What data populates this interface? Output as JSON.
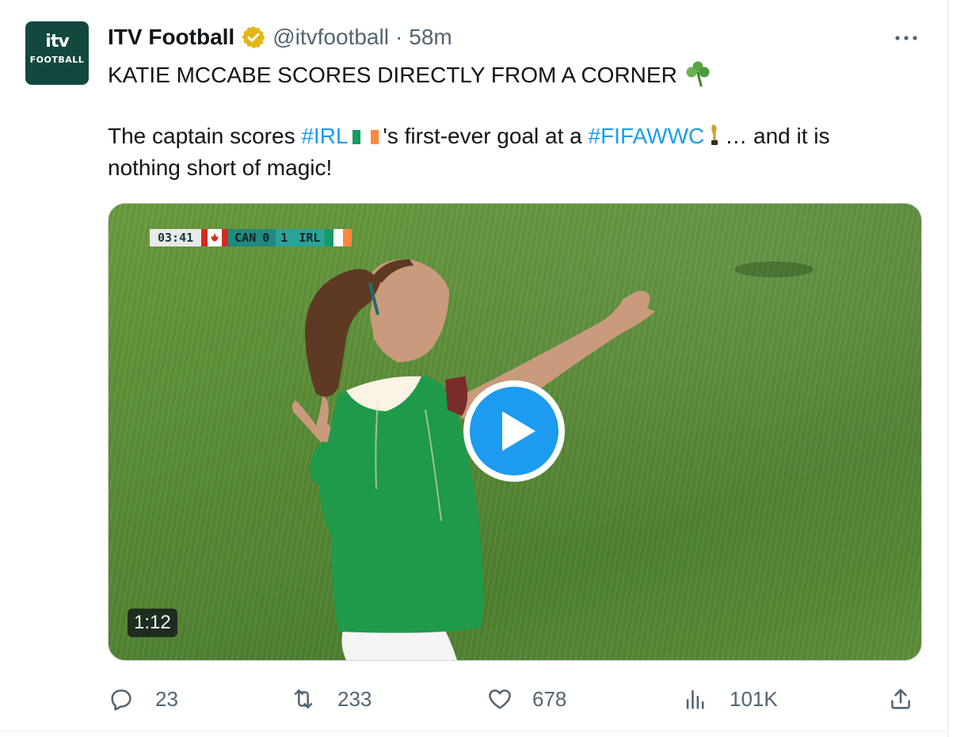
{
  "account": {
    "display_name": "ITV Football",
    "handle": "@itvfootball",
    "separator": "·",
    "time_ago": "58m",
    "avatar_text": "itv",
    "avatar_subtext": "FOOTBALL"
  },
  "icons": {
    "verified": "verified-badge-icon",
    "more": "more-options-icon",
    "reply": "reply-icon",
    "retweet": "retweet-icon",
    "like": "heart-icon",
    "views": "views-icon",
    "share": "share-icon",
    "shamrock": "shamrock-icon",
    "trophy": "trophy-icon",
    "flag": "ireland-flag-icon"
  },
  "tweet": {
    "headline": "KATIE MCCABE SCORES DIRECTLY FROM A CORNER",
    "line2_before": "The captain scores ",
    "hashtag_irl": "#IRL",
    "line2_mid": "'s first-ever goal at a ",
    "hashtag_wwc": "#FIFAWWC",
    "line2_after": "… and it is",
    "line3": "nothing short of magic!"
  },
  "video": {
    "duration": "1:12",
    "scorebug": {
      "clock": "03:41",
      "home": "CAN",
      "home_score": "0",
      "away_score": "1",
      "away": "IRL"
    }
  },
  "metrics": {
    "replies": "23",
    "retweets": "233",
    "likes": "678",
    "views": "101K"
  },
  "colors": {
    "link": "#1d9bf0",
    "secondary_text": "#536471",
    "avatar_bg": "#13483f",
    "verified_gold": "#e2b719",
    "play_button": "#1d9bf0"
  }
}
